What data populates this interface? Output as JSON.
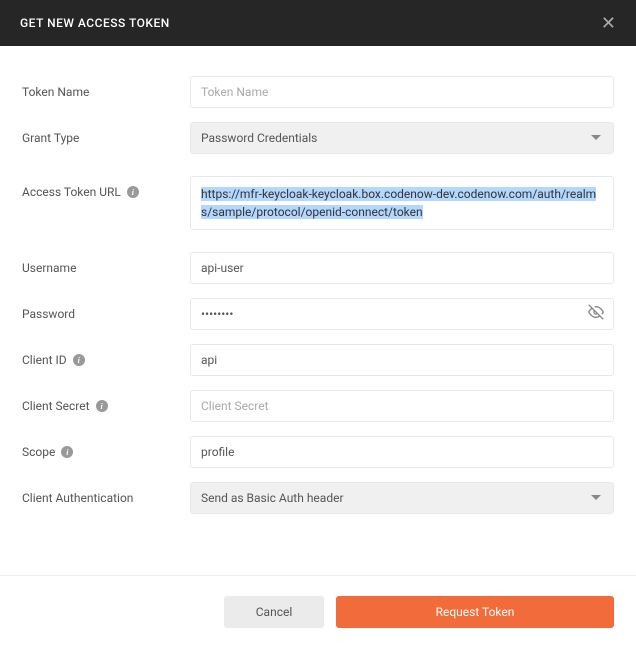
{
  "header": {
    "title": "GET NEW ACCESS TOKEN"
  },
  "form": {
    "tokenName": {
      "label": "Token Name",
      "placeholder": "Token Name",
      "value": ""
    },
    "grantType": {
      "label": "Grant Type",
      "value": "Password Credentials"
    },
    "accessTokenUrl": {
      "label": "Access Token URL",
      "value": "https://mfr-keycloak-keycloak.box.codenow-dev.codenow.com/auth/realms/sample/protocol/openid-connect/token"
    },
    "username": {
      "label": "Username",
      "value": "api-user"
    },
    "password": {
      "label": "Password",
      "value": "••••••••"
    },
    "clientId": {
      "label": "Client ID",
      "value": "api"
    },
    "clientSecret": {
      "label": "Client Secret",
      "placeholder": "Client Secret",
      "value": ""
    },
    "scope": {
      "label": "Scope",
      "value": "profile"
    },
    "clientAuth": {
      "label": "Client Authentication",
      "value": "Send as Basic Auth header"
    }
  },
  "footer": {
    "cancel": "Cancel",
    "requestToken": "Request Token"
  }
}
